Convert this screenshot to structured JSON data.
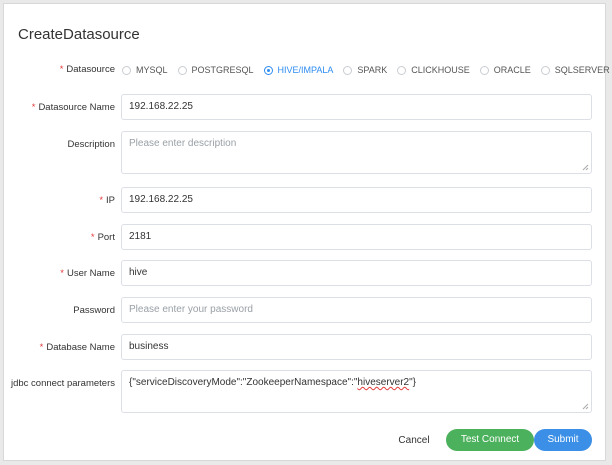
{
  "dialog": {
    "title": "CreateDatasource"
  },
  "form": {
    "datasource": {
      "label": "Datasource",
      "options": [
        "MYSQL",
        "POSTGRESQL",
        "HIVE/IMPALA",
        "SPARK",
        "CLICKHOUSE",
        "ORACLE",
        "SQLSERVER"
      ],
      "selected": "HIVE/IMPALA"
    },
    "datasource_name": {
      "label": "Datasource Name",
      "value": "192.168.22.25"
    },
    "description": {
      "label": "Description",
      "placeholder": "Please enter description"
    },
    "ip": {
      "label": "IP",
      "value": "192.168.22.25"
    },
    "port": {
      "label": "Port",
      "value": "2181"
    },
    "user_name": {
      "label": "User Name",
      "value": "hive"
    },
    "password": {
      "label": "Password",
      "placeholder": "Please enter your password"
    },
    "database_name": {
      "label": "Database Name",
      "value": "business"
    },
    "jdbc": {
      "label": "jdbc connect parameters",
      "value_prefix": "{\"serviceDiscoveryMode\":\"ZookeeperNamespace\":\"",
      "value_misspelled": "hiveserver2",
      "value_suffix": "\"}"
    }
  },
  "actions": {
    "cancel": "Cancel",
    "test_connect": "Test Connect",
    "submit": "Submit"
  },
  "colors": {
    "primary": "#3b8fe6",
    "success": "#4cb15c",
    "required": "#e23b3b"
  },
  "required_mark": "*"
}
